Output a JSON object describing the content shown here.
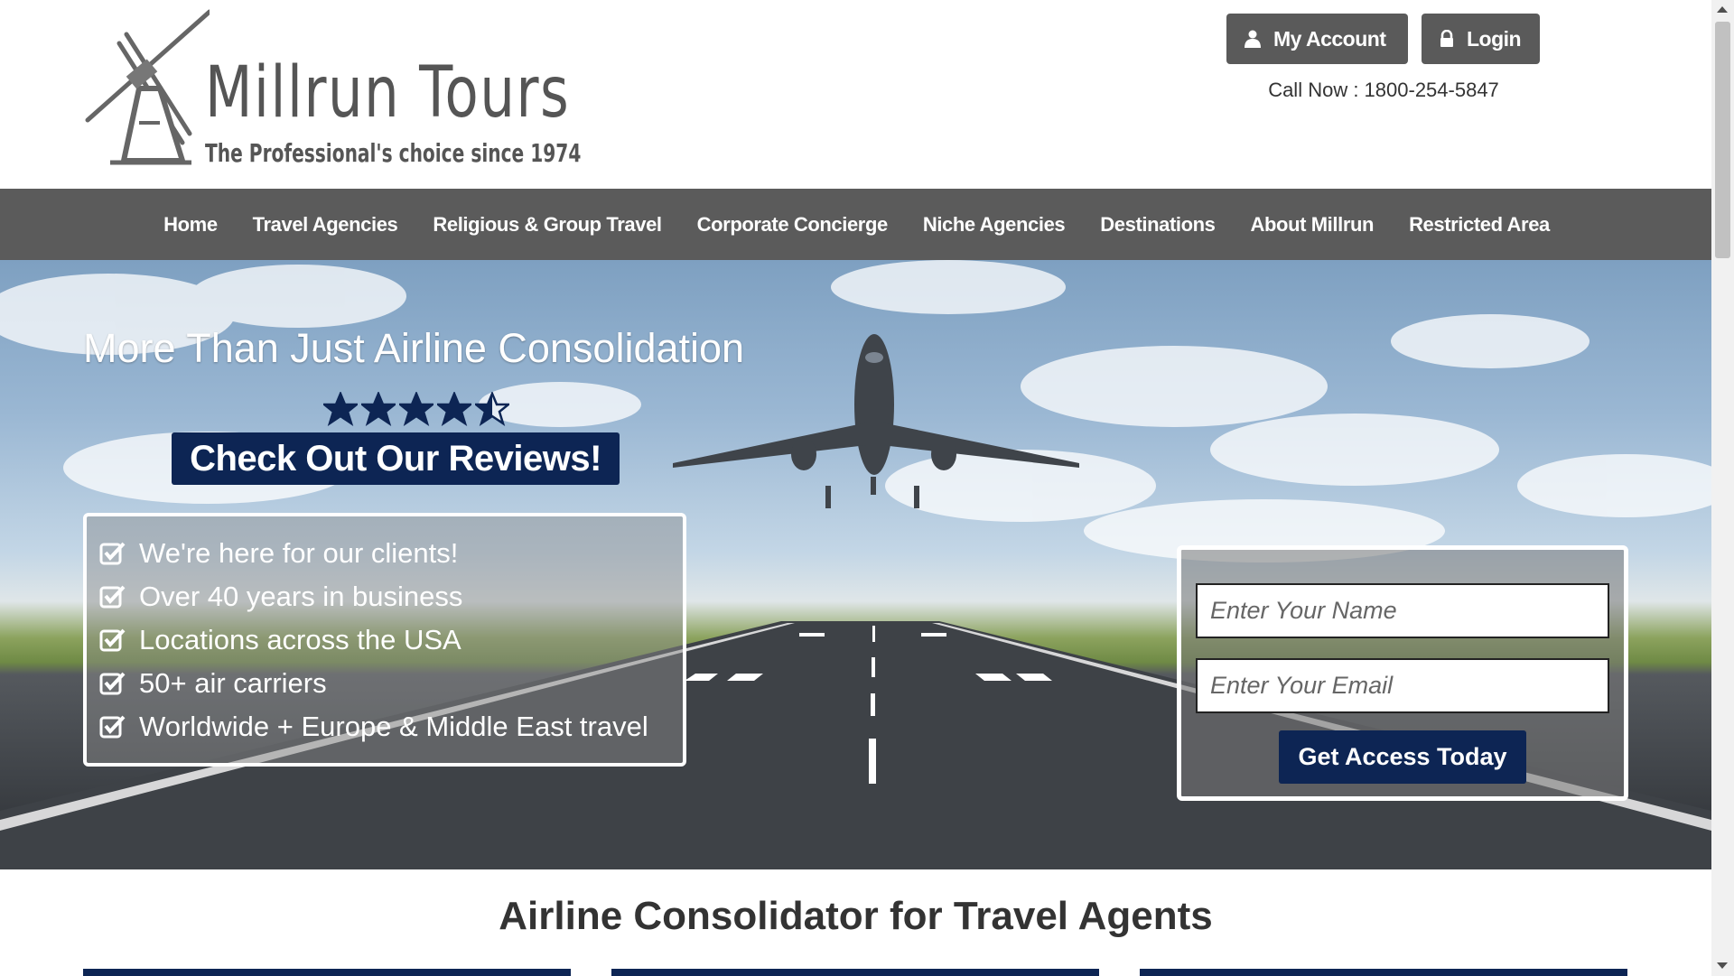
{
  "header": {
    "logo_title": "Millrun Tours",
    "logo_tagline": "The Professional's choice since 1974",
    "my_account_label": "My Account",
    "login_label": "Login",
    "call_now": "Call Now : 1800-254-5847"
  },
  "nav": {
    "items": [
      "Home",
      "Travel Agencies",
      "Religious & Group Travel",
      "Corporate Concierge",
      "Niche Agencies",
      "Destinations",
      "About Millrun",
      "Restricted Area"
    ]
  },
  "hero": {
    "title": "More Than Just Airline Consolidation",
    "rating": 4.5,
    "rating_max": 5,
    "reviews_button": "Check Out Our Reviews!",
    "features": [
      "We're here for our clients!",
      "Over 40 years in business",
      "Locations across the USA",
      "50+ air carriers",
      "Worldwide + Europe & Middle East travel"
    ],
    "form": {
      "name_placeholder": "Enter Your Name",
      "email_placeholder": "Enter Your Email",
      "submit_label": "Get Access Today"
    }
  },
  "section": {
    "title": "Airline Consolidator for Travel Agents"
  },
  "icons": {
    "account": "user-icon",
    "login": "lock-icon",
    "feature": "checkbox-checked-icon",
    "star": "star-icon"
  },
  "colors": {
    "brand_navy": "#0d2554",
    "nav_gray": "#5b5b5b",
    "button_gray": "#5a5a5a"
  }
}
